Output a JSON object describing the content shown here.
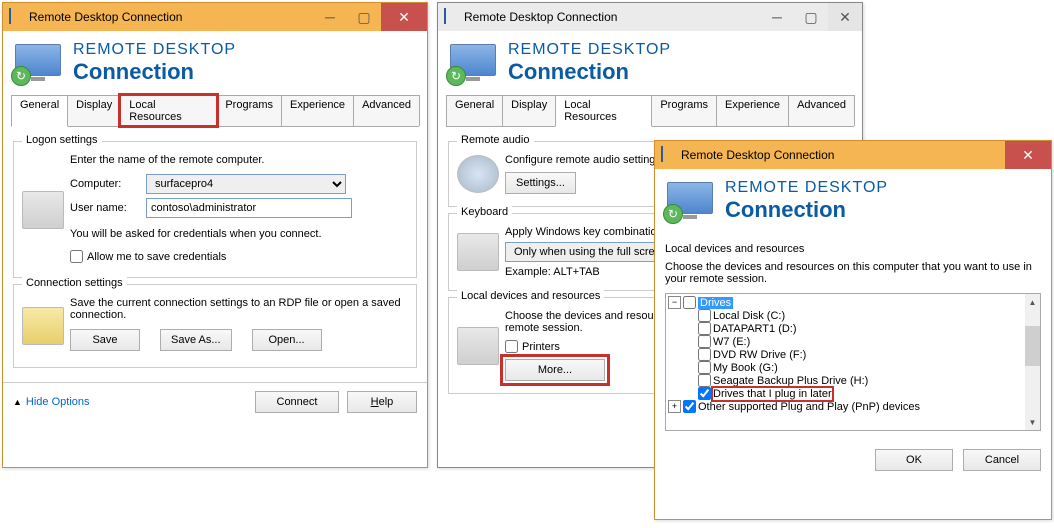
{
  "app_title": "Remote Desktop Connection",
  "header": {
    "line1": "REMOTE DESKTOP",
    "line2": "Connection"
  },
  "tabs": {
    "general": "General",
    "display": "Display",
    "local_resources": "Local Resources",
    "programs": "Programs",
    "experience": "Experience",
    "advanced": "Advanced"
  },
  "general": {
    "logon_legend": "Logon settings",
    "prompt": "Enter the name of the remote computer.",
    "computer_label": "Computer:",
    "computer_value": "surfacepro4",
    "user_label": "User name:",
    "user_value": "contoso\\administrator",
    "cred_note": "You will be asked for credentials when you connect.",
    "allow_save": "Allow me to save credentials",
    "conn_legend": "Connection settings",
    "conn_text": "Save the current connection settings to an RDP file or open a saved connection.",
    "save": "Save",
    "save_as": "Save As...",
    "open": "Open...",
    "hide_options": "Hide Options",
    "connect": "Connect",
    "help": "Help"
  },
  "local": {
    "audio_legend": "Remote audio",
    "audio_text": "Configure remote audio settings.",
    "settings_btn": "Settings...",
    "kb_legend": "Keyboard",
    "kb_text": "Apply Windows key combinations:",
    "kb_select": "Only when using the full screen",
    "kb_example": "Example: ALT+TAB",
    "dev_legend": "Local devices and resources",
    "dev_text": "Choose the devices and resources that you want to use in your remote session.",
    "printers": "Printers",
    "more_btn": "More..."
  },
  "dlg": {
    "title": "Remote Desktop Connection",
    "legend": "Local devices and resources",
    "intro": "Choose the devices and resources on this computer that you want to use in your remote session.",
    "drives": "Drives",
    "items": [
      "Local Disk (C:)",
      "DATAPART1 (D:)",
      "W7 (E:)",
      "DVD RW Drive (F:)",
      "My Book (G:)",
      "Seagate Backup Plus Drive (H:)"
    ],
    "plug_later": "Drives that I plug in later",
    "other_pnp": "Other supported Plug and Play (PnP) devices",
    "ok": "OK",
    "cancel": "Cancel"
  }
}
